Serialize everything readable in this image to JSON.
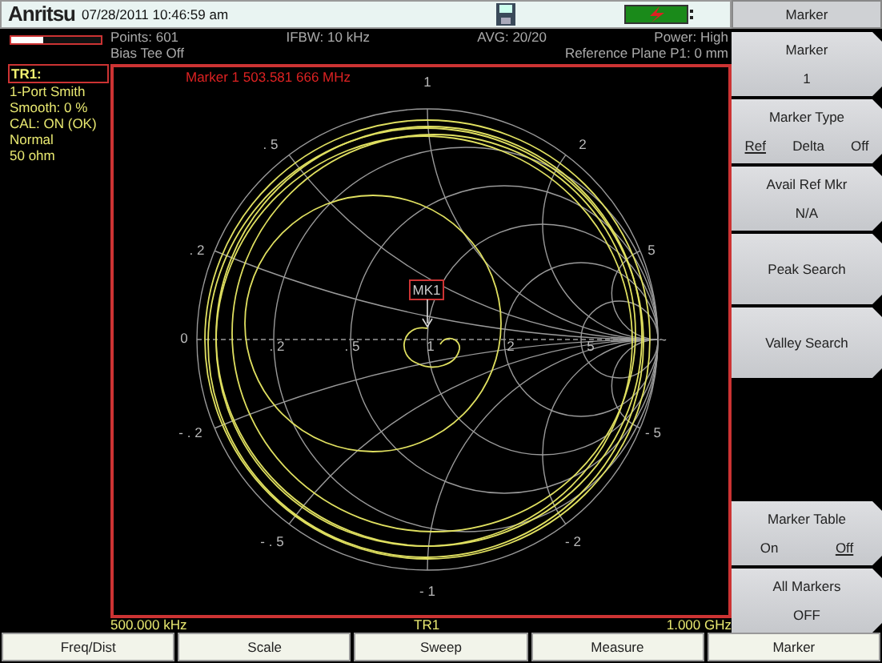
{
  "top_bar": {
    "logo": "Anritsu",
    "datetime": "07/28/2011 10:46:59 am"
  },
  "sweep_progress": {
    "level": 0.35
  },
  "status": {
    "row_1": [
      "Points: 601",
      "IFBW: 10 kHz",
      "AVG: 20/20",
      "Power: High"
    ],
    "row_2": [
      "Bias Tee Off",
      "Reference Plane P1: 0 mm"
    ]
  },
  "trace_panel": {
    "title": "TR1:",
    "lines": [
      "1-Port Smith",
      "Smooth: 0 %",
      "CAL: ON (OK)",
      "Normal",
      "50 ohm"
    ]
  },
  "plot": {
    "marker_readout": "Marker 1 503.581 666 MHz",
    "marker_label": "MK1",
    "grid_labels": [
      "1",
      ". 5",
      "2",
      ". 2",
      "5",
      "0",
      ". 2",
      ". 5",
      "1",
      "2",
      "5",
      "~",
      "- . 2",
      "- 5",
      "- . 5",
      "- 2",
      "- 1"
    ],
    "start": "500.000 kHz",
    "trace": "TR1",
    "stop": "1.000 GHz"
  },
  "menu": {
    "title": "Marker",
    "keys": [
      {
        "kind": "value",
        "label": "Marker",
        "value": "1"
      },
      {
        "kind": "choice",
        "label": "Marker Type",
        "options": [
          {
            "text": "Ref",
            "selected": true
          },
          {
            "text": "Delta",
            "selected": false
          },
          {
            "text": "Off",
            "selected": false
          }
        ]
      },
      {
        "kind": "value",
        "label": "Avail Ref Mkr",
        "value": "N/A"
      },
      {
        "kind": "action",
        "label": "Peak Search"
      },
      {
        "kind": "action",
        "label": "Valley Search"
      }
    ],
    "lower_keys": [
      {
        "kind": "choice",
        "label": "Marker Table",
        "options": [
          {
            "text": "On",
            "selected": false
          },
          {
            "text": "Off",
            "selected": true
          }
        ]
      },
      {
        "kind": "value",
        "label": "All Markers",
        "value": "OFF"
      }
    ]
  },
  "tabs": [
    {
      "label": "Freq/Dist"
    },
    {
      "label": "Scale"
    },
    {
      "label": "Sweep"
    },
    {
      "label": "Measure"
    },
    {
      "label": "Marker"
    }
  ]
}
